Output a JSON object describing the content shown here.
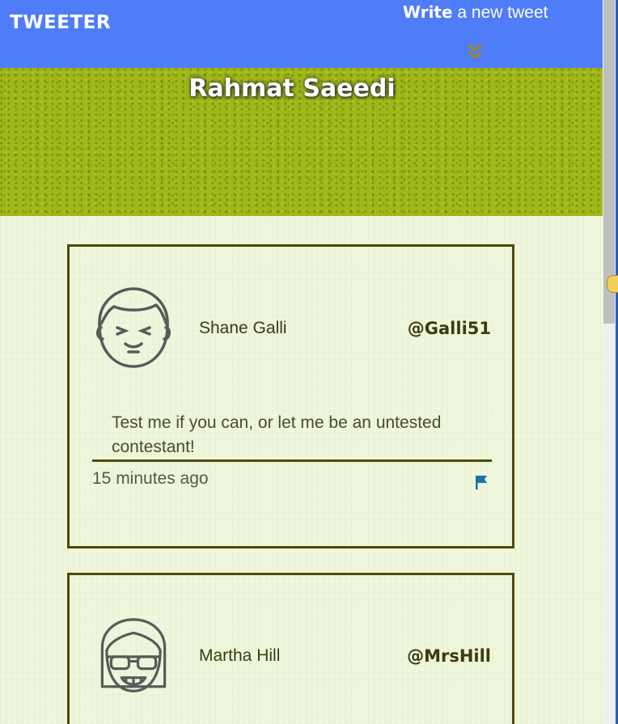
{
  "nav": {
    "logo": "TWEETER",
    "compose_bold": "Write",
    "compose_rest": " a new tweet"
  },
  "profile": {
    "name": "Rahmat Saeedi"
  },
  "tweets": [
    {
      "name": "Shane Galli",
      "handle": "@Galli51",
      "content": "Test me if you can, or let me be an untested contestant!",
      "time": "15 minutes ago",
      "avatar_icon": "smiling-man-avatar-icon"
    },
    {
      "name": "Martha Hill",
      "handle": "@MrsHill",
      "avatar_icon": "woman-with-glasses-avatar-icon"
    }
  ],
  "colors": {
    "nav": "#4f7cf7",
    "banner": "#9fb719",
    "background": "#eef7dc",
    "border": "#4d4a00",
    "flag": "#1f6fb0"
  }
}
